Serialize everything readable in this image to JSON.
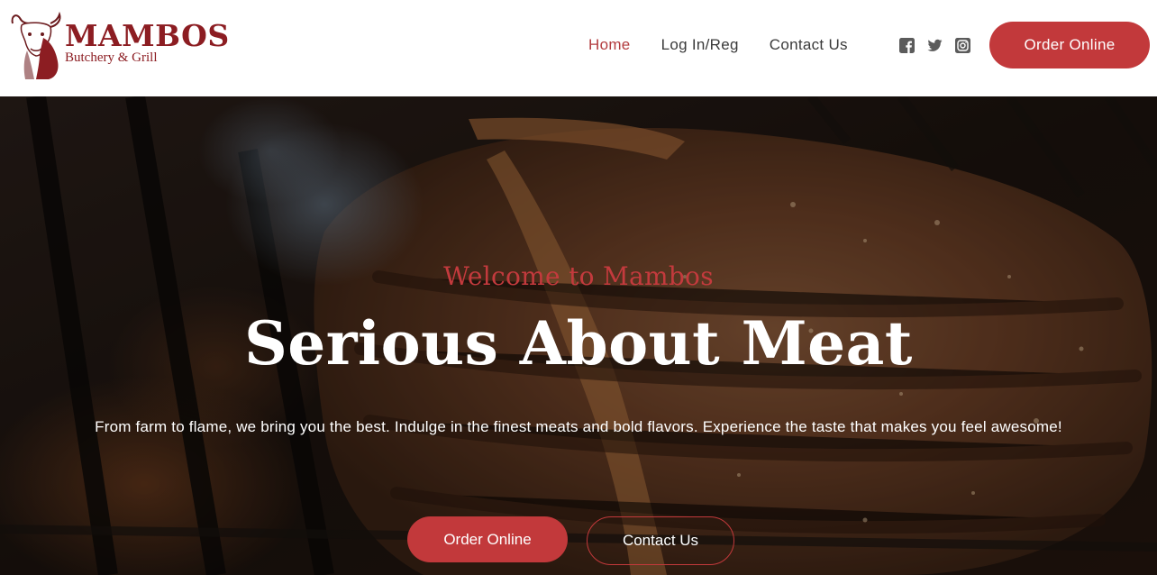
{
  "brand": {
    "name": "MAMBOS",
    "tagline": "Butchery & Grill",
    "color": "#8c1d22"
  },
  "nav": {
    "items": [
      {
        "label": "Home",
        "active": true
      },
      {
        "label": "Log In/Reg",
        "active": false
      },
      {
        "label": "Contact Us",
        "active": false
      }
    ]
  },
  "social": {
    "icons": [
      "facebook-icon",
      "twitter-icon",
      "instagram-icon"
    ]
  },
  "header_cta": {
    "label": "Order Online"
  },
  "hero": {
    "eyebrow": "Welcome to Mambos",
    "title": "Serious About Meat",
    "description": "From farm to flame, we bring you the best. Indulge in the finest meats and bold flavors. Experience the taste that makes you feel awesome!",
    "primary_button": "Order Online",
    "secondary_button": "Contact Us"
  },
  "colors": {
    "accent": "#c2393b",
    "nav_active": "#b33c3f",
    "nav_text": "#3a3a3a"
  }
}
